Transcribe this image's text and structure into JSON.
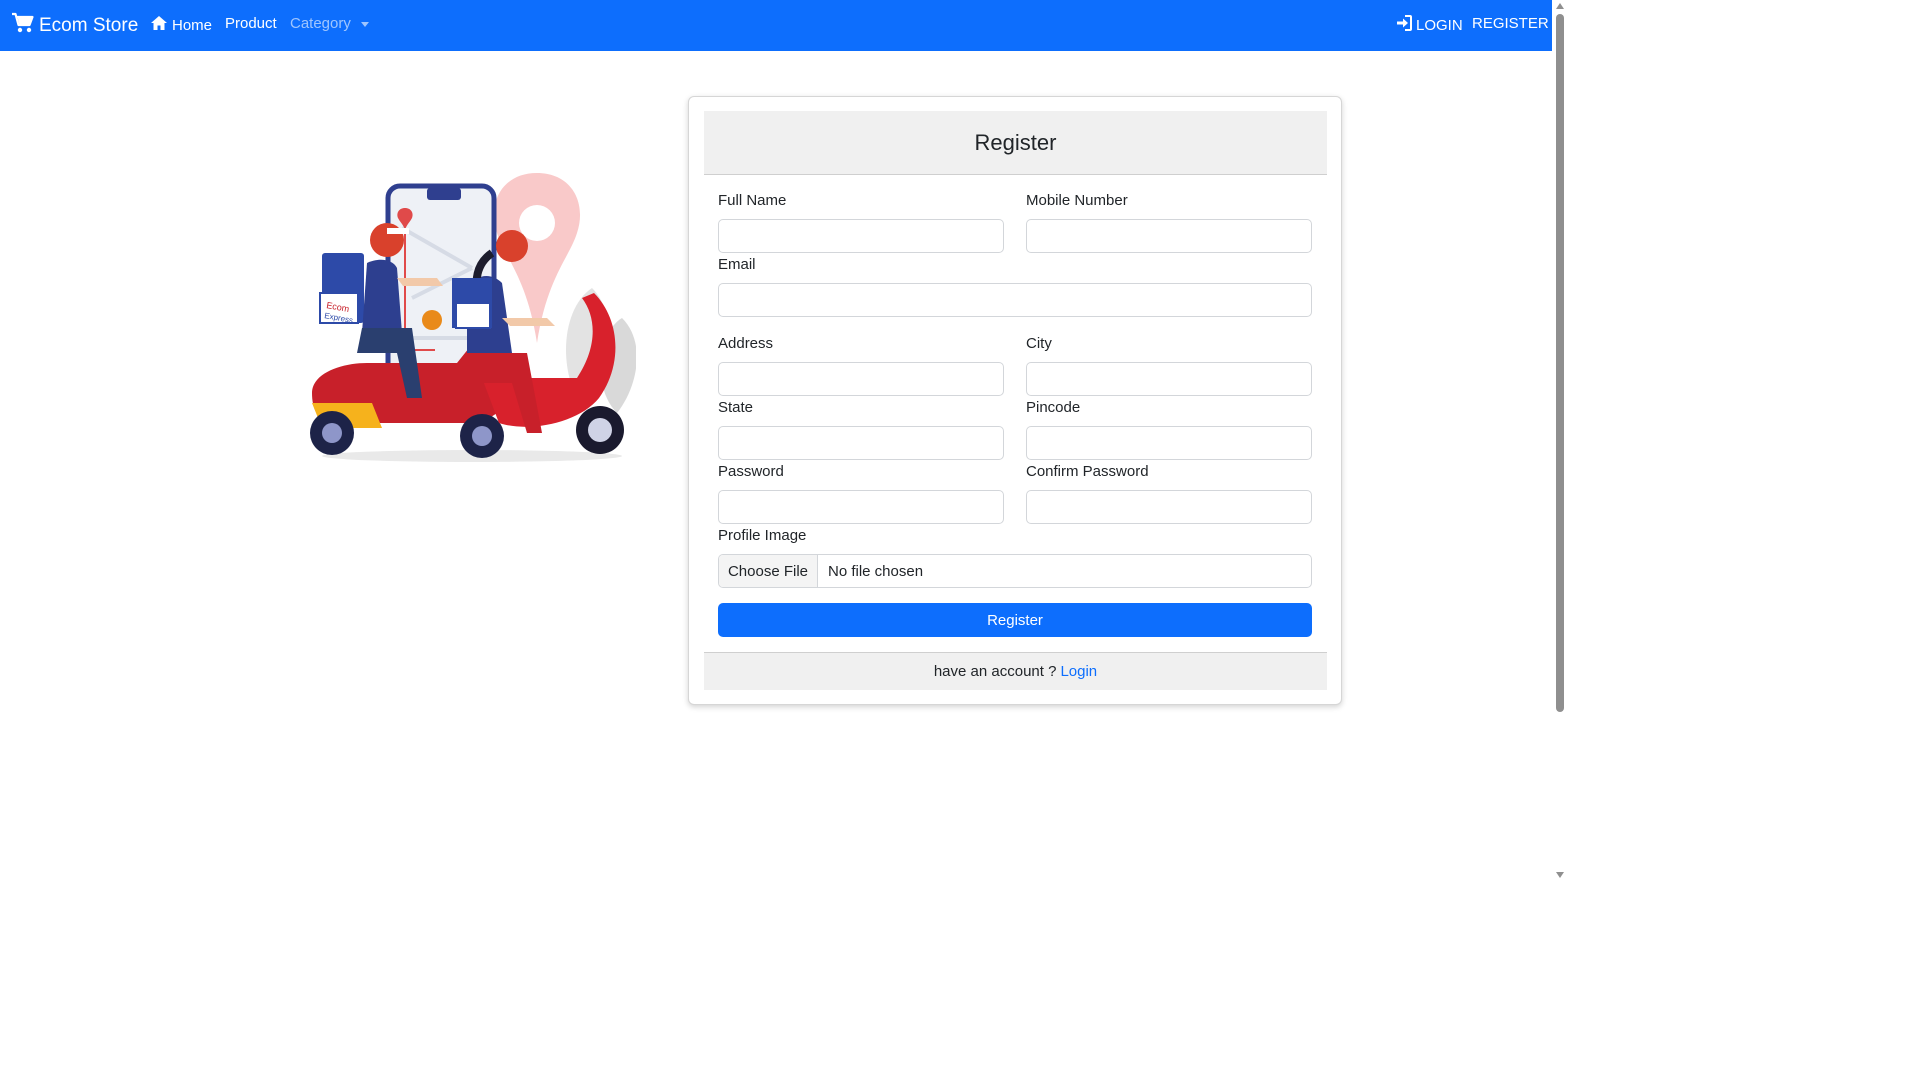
{
  "navbar": {
    "brand": "Ecom Store",
    "home": "Home",
    "product": "Product",
    "category": "Category",
    "login": "LOGIN",
    "register": "REGISTER",
    "color": "#0d6efd"
  },
  "illustration": {
    "badge_text_1": "Ecom",
    "badge_text_2": "Express"
  },
  "form": {
    "title": "Register",
    "full_name_label": "Full Name",
    "mobile_label": "Mobile Number",
    "email_label": "Email",
    "address_label": "Address",
    "city_label": "City",
    "state_label": "State",
    "pincode_label": "Pincode",
    "password_label": "Password",
    "confirm_password_label": "Confirm Password",
    "profile_image_label": "Profile Image",
    "choose_file": "Choose File",
    "no_file": "No file chosen",
    "submit": "Register",
    "footer_text": "have an account ?",
    "footer_link": "Login",
    "values": {
      "full_name": "",
      "mobile": "",
      "email": "",
      "address": "",
      "city": "",
      "state": "",
      "pincode": "",
      "password": "",
      "confirm_password": ""
    }
  },
  "icons": {
    "brand": "cart-icon",
    "home": "home-icon",
    "login": "sign-in-icon"
  }
}
